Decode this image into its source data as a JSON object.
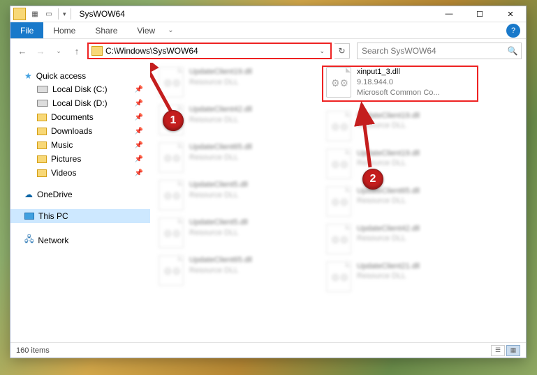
{
  "window": {
    "title": "SysWOW64"
  },
  "ribbon": {
    "file": "File",
    "tabs": [
      "Home",
      "Share",
      "View"
    ]
  },
  "nav": {
    "path": "C:\\Windows\\SysWOW64",
    "search_placeholder": "Search SysWOW64"
  },
  "sidebar": {
    "quick_access": "Quick access",
    "items": [
      {
        "label": "Local Disk (C:)",
        "kind": "drive"
      },
      {
        "label": "Local Disk (D:)",
        "kind": "drive"
      },
      {
        "label": "Documents",
        "kind": "folder"
      },
      {
        "label": "Downloads",
        "kind": "folder"
      },
      {
        "label": "Music",
        "kind": "folder"
      },
      {
        "label": "Pictures",
        "kind": "folder"
      },
      {
        "label": "Videos",
        "kind": "folder"
      }
    ],
    "onedrive": "OneDrive",
    "this_pc": "This PC",
    "network": "Network"
  },
  "files": {
    "highlighted": {
      "name": "xinput1_3.dll",
      "version": "9.18.944.0",
      "desc": "Microsoft Common Co..."
    },
    "blurred_col1": [
      {
        "name": "UpdateClient19.dll",
        "sub": "Resource DLL"
      },
      {
        "name": "UpdateClient42.dll",
        "sub": "Resource DLL"
      },
      {
        "name": "UpdateClient65.dll",
        "sub": "Resource DLL"
      },
      {
        "name": "UpdateClient5.dll",
        "sub": "Resource DLL"
      },
      {
        "name": "UpdateClient5.dll",
        "sub": "Resource DLL"
      },
      {
        "name": "UpdateClient65.dll",
        "sub": "Resource DLL"
      }
    ],
    "blurred_col2": [
      {
        "name": "UpdateClient19.dll",
        "sub": "Resource DLL"
      },
      {
        "name": "UpdateClient19.dll",
        "sub": "Resource DLL"
      },
      {
        "name": "UpdateClient65.dll",
        "sub": "Resource DLL"
      },
      {
        "name": "UpdateClient42.dll",
        "sub": "Resource DLL"
      },
      {
        "name": "UpdateClient21.dll",
        "sub": "Resource DLL"
      }
    ]
  },
  "status": {
    "count": "160 items"
  },
  "callouts": {
    "one": "1",
    "two": "2"
  }
}
